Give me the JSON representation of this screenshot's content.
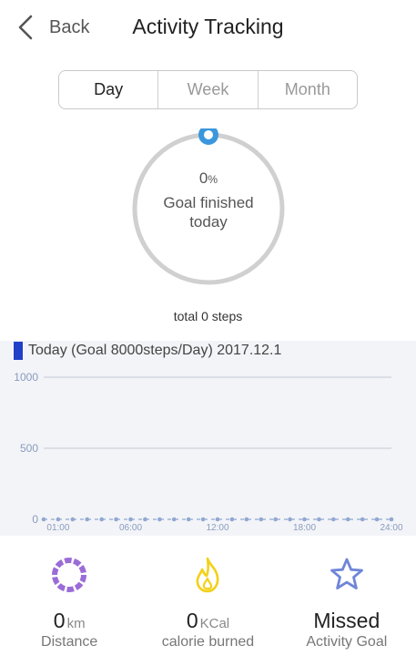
{
  "header": {
    "back_label": "Back",
    "title": "Activity Tracking"
  },
  "tabs": [
    {
      "label": "Day",
      "active": true
    },
    {
      "label": "Week",
      "active": false
    },
    {
      "label": "Month",
      "active": false
    }
  ],
  "progress": {
    "percent_value": "0",
    "percent_sign": "%",
    "line1": "Goal finished",
    "line2": "today",
    "fraction": 0
  },
  "total_steps": "total 0 steps",
  "chart_data": {
    "type": "line",
    "title": "Today (Goal 8000steps/Day) 2017.12.1",
    "y_ticks": [
      "1000",
      "500",
      "0"
    ],
    "x_ticks": [
      "01:00",
      "06:00",
      "12:00",
      "18:00",
      "24:00"
    ],
    "ylim": [
      0,
      1000
    ],
    "x": [
      0,
      1,
      2,
      3,
      4,
      5,
      6,
      7,
      8,
      9,
      10,
      11,
      12,
      13,
      14,
      15,
      16,
      17,
      18,
      19,
      20,
      21,
      22,
      23,
      24
    ],
    "values": [
      0,
      0,
      0,
      0,
      0,
      0,
      0,
      0,
      0,
      0,
      0,
      0,
      0,
      0,
      0,
      0,
      0,
      0,
      0,
      0,
      0,
      0,
      0,
      0,
      0
    ],
    "grid": true,
    "color": "#90a8d0"
  },
  "stats": [
    {
      "value": "0",
      "unit": "km",
      "label": "Distance",
      "icon": "distance-ring-icon",
      "color": "#9b6cd8"
    },
    {
      "value": "0",
      "unit": "KCal",
      "label": "calorie burned",
      "icon": "flame-icon",
      "color": "#f2d11a"
    },
    {
      "value": "Missed",
      "unit": "",
      "label": "Activity Goal",
      "icon": "star-icon",
      "color": "#6f86d8"
    }
  ],
  "colors": {
    "accent": "#3b97dd",
    "ring_track": "#d0d0d0",
    "legend": "#2040c8"
  }
}
